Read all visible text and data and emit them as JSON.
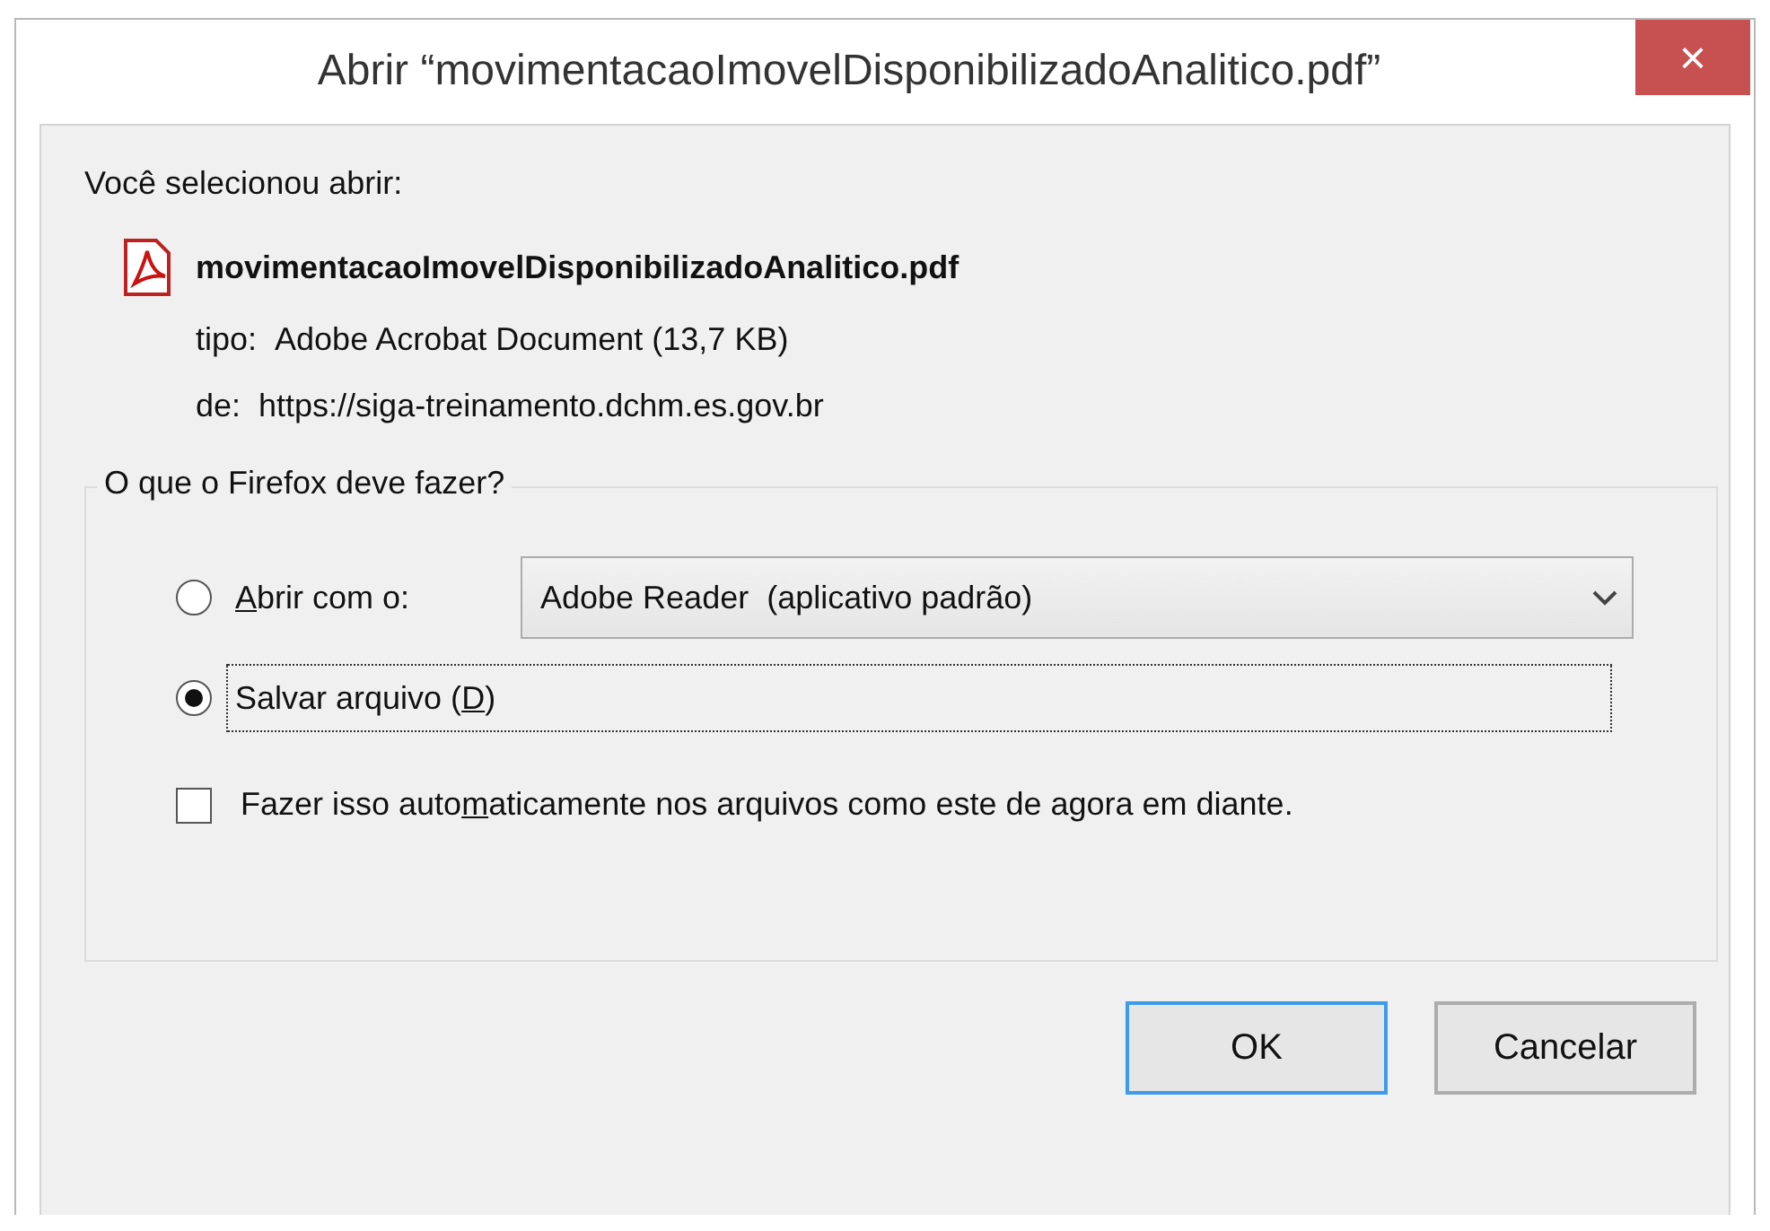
{
  "window": {
    "title": "Abrir “movimentacaoImovelDisponibilizadoAnalitico.pdf”",
    "close": "×"
  },
  "intro": "Você selecionou abrir:",
  "file": {
    "name": "movimentacaoImovelDisponibilizadoAnalitico.pdf",
    "details": [
      {
        "label": "tipo:",
        "value": "Adobe Acrobat Document (13,7 KB)"
      },
      {
        "label": "de:",
        "value": "https://siga-treinamento.dchm.es.gov.br"
      }
    ]
  },
  "group": {
    "legend": "O que o Firefox deve fazer?",
    "options": [
      {
        "kind": "open-with",
        "label": {
          "key": "A",
          "after": "brir com o:"
        },
        "selected": false,
        "app": "Adobe Reader  (aplicativo padrão)"
      },
      {
        "kind": "save",
        "label": {
          "before": "Salvar arquivo (",
          "key": "D",
          "after": ")"
        },
        "selected": true
      }
    ],
    "auto": {
      "label": {
        "before": "Fazer isso auto",
        "key": "m",
        "after": "aticamente nos arquivos como este de agora em diante."
      },
      "checked": false
    }
  },
  "buttons": [
    {
      "label": "OK",
      "default": true
    },
    {
      "label": "Cancelar",
      "default": false
    }
  ]
}
